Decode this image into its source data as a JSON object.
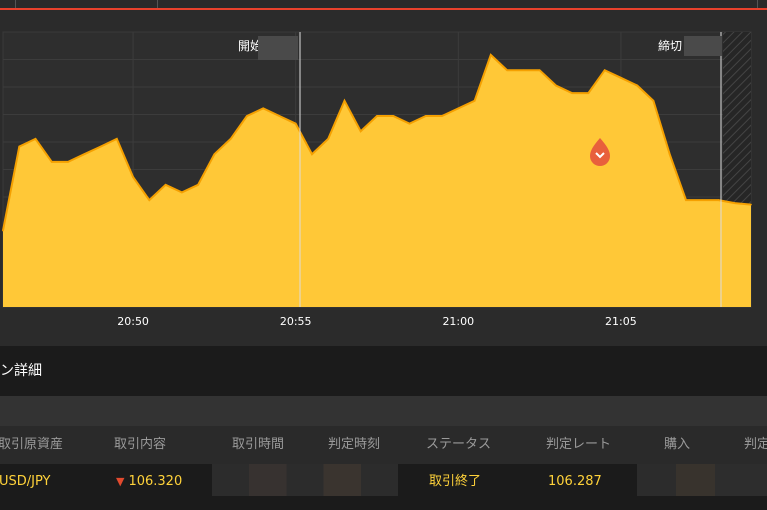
{
  "chart_data": {
    "type": "area",
    "x_start": "20:46",
    "x_end": "21:09",
    "x_ticks": [
      "20:50",
      "20:55",
      "21:00",
      "21:05"
    ],
    "ylim": [
      106.22,
      106.4
    ],
    "grid": true,
    "start_label": "開始",
    "end_label": "締切",
    "series": [
      {
        "x": [
          "20:46",
          "20:46:30",
          "20:47",
          "20:47:30",
          "20:48",
          "20:48:30",
          "20:49",
          "20:49:30",
          "20:50",
          "20:50:30",
          "20:51",
          "20:51:30",
          "20:52",
          "20:52:30",
          "20:53",
          "20:53:30",
          "20:54",
          "20:54:30",
          "20:55",
          "20:55:30",
          "20:56",
          "20:56:30",
          "20:57",
          "20:57:30",
          "20:58",
          "20:58:30",
          "20:59",
          "20:59:30",
          "21:00",
          "21:00:30",
          "21:01",
          "21:01:30",
          "21:02",
          "21:02:30",
          "21:03",
          "21:03:30",
          "21:04",
          "21:04:30",
          "21:05",
          "21:05:30",
          "21:06",
          "21:06:30",
          "21:07",
          "21:07:30",
          "21:08",
          "21:08:30",
          "21:09"
        ],
        "values": [
          106.27,
          106.325,
          106.33,
          106.315,
          106.315,
          106.32,
          106.325,
          106.33,
          106.305,
          106.29,
          106.3,
          106.295,
          106.3,
          106.32,
          106.33,
          106.345,
          106.35,
          106.345,
          106.34,
          106.32,
          106.33,
          106.355,
          106.335,
          106.345,
          106.345,
          106.34,
          106.345,
          106.345,
          106.35,
          106.355,
          106.385,
          106.375,
          106.375,
          106.375,
          106.365,
          106.36,
          106.36,
          106.375,
          106.37,
          106.365,
          106.355,
          106.32,
          106.29,
          106.29,
          106.29,
          106.288,
          106.287
        ]
      }
    ]
  },
  "markers": {
    "entry_icon": "entry-marker-icon"
  },
  "section": {
    "title": "ン詳細"
  },
  "table": {
    "headers": [
      "取引原資産",
      "取引内容",
      "取引時間",
      "判定時刻",
      "ステータス",
      "判定レート",
      "購入",
      "判定"
    ],
    "row": {
      "asset": "USD/JPY",
      "direction_icon": "down-arrow-icon",
      "rate": "106.320",
      "status": "取引終了",
      "judge_rate": "106.287"
    }
  },
  "colors": {
    "area_fill": "#ffc837",
    "area_stroke": "#f5a000",
    "marker": "#e8603c",
    "accent_red": "#e8412c",
    "status_yellow": "#ffd23a"
  }
}
